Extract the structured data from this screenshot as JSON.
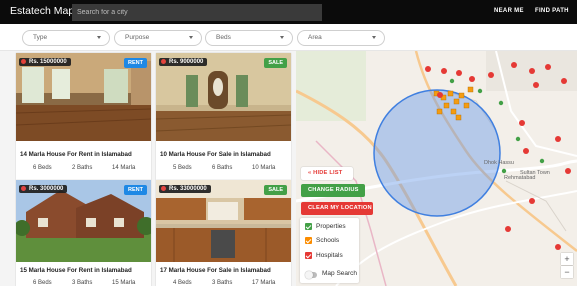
{
  "header": {
    "brand": "Estatech Maps",
    "search_placeholder": "Search for a city",
    "nav": [
      "NEAR ME",
      "FIND PATH"
    ]
  },
  "filters": [
    "Type",
    "Purpose",
    "Beds",
    "Area"
  ],
  "listings": [
    {
      "price": "Rs. 15000000",
      "badge": "RENT",
      "title": "14 Marla House For Rent in Islamabad",
      "beds": "6 Beds",
      "baths": "2 Baths",
      "area": "14 Marla"
    },
    {
      "price": "Rs. 9000000",
      "badge": "SALE",
      "title": "10 Marla House For Sale in Islamabad",
      "beds": "5 Beds",
      "baths": "6 Baths",
      "area": "10 Marla"
    },
    {
      "price": "Rs. 3000000",
      "badge": "RENT",
      "title": "15 Marla House For Rent in Islamabad",
      "beds": "6 Beds",
      "baths": "3 Baths",
      "area": "15 Marla"
    },
    {
      "price": "Rs. 33000000",
      "badge": "SALE",
      "title": "17 Marla House For Sale in Islamabad",
      "beds": "4 Beds",
      "baths": "3 Baths",
      "area": "17 Marla"
    }
  ],
  "map": {
    "hide_list": "HIDE LIST",
    "change_radius": "CHANGE RADIUS",
    "clear_location": "CLEAR MY LOCATION",
    "layers": [
      {
        "label": "Properties",
        "color": "#43a047"
      },
      {
        "label": "Schools",
        "color": "#fb8c00"
      },
      {
        "label": "Hospitals",
        "color": "#e53935"
      }
    ],
    "map_search": "Map Search",
    "zoom_in": "+",
    "zoom_out": "−",
    "places": [
      "Dhok Hassu",
      "Rehmatabad",
      "Sultan Town"
    ]
  },
  "colors": {
    "rent": "#1e88e5",
    "sale": "#43a047",
    "hide": "#ffffff",
    "change": "#43a047",
    "clear": "#e53935",
    "radius": "#3f7fe0"
  }
}
